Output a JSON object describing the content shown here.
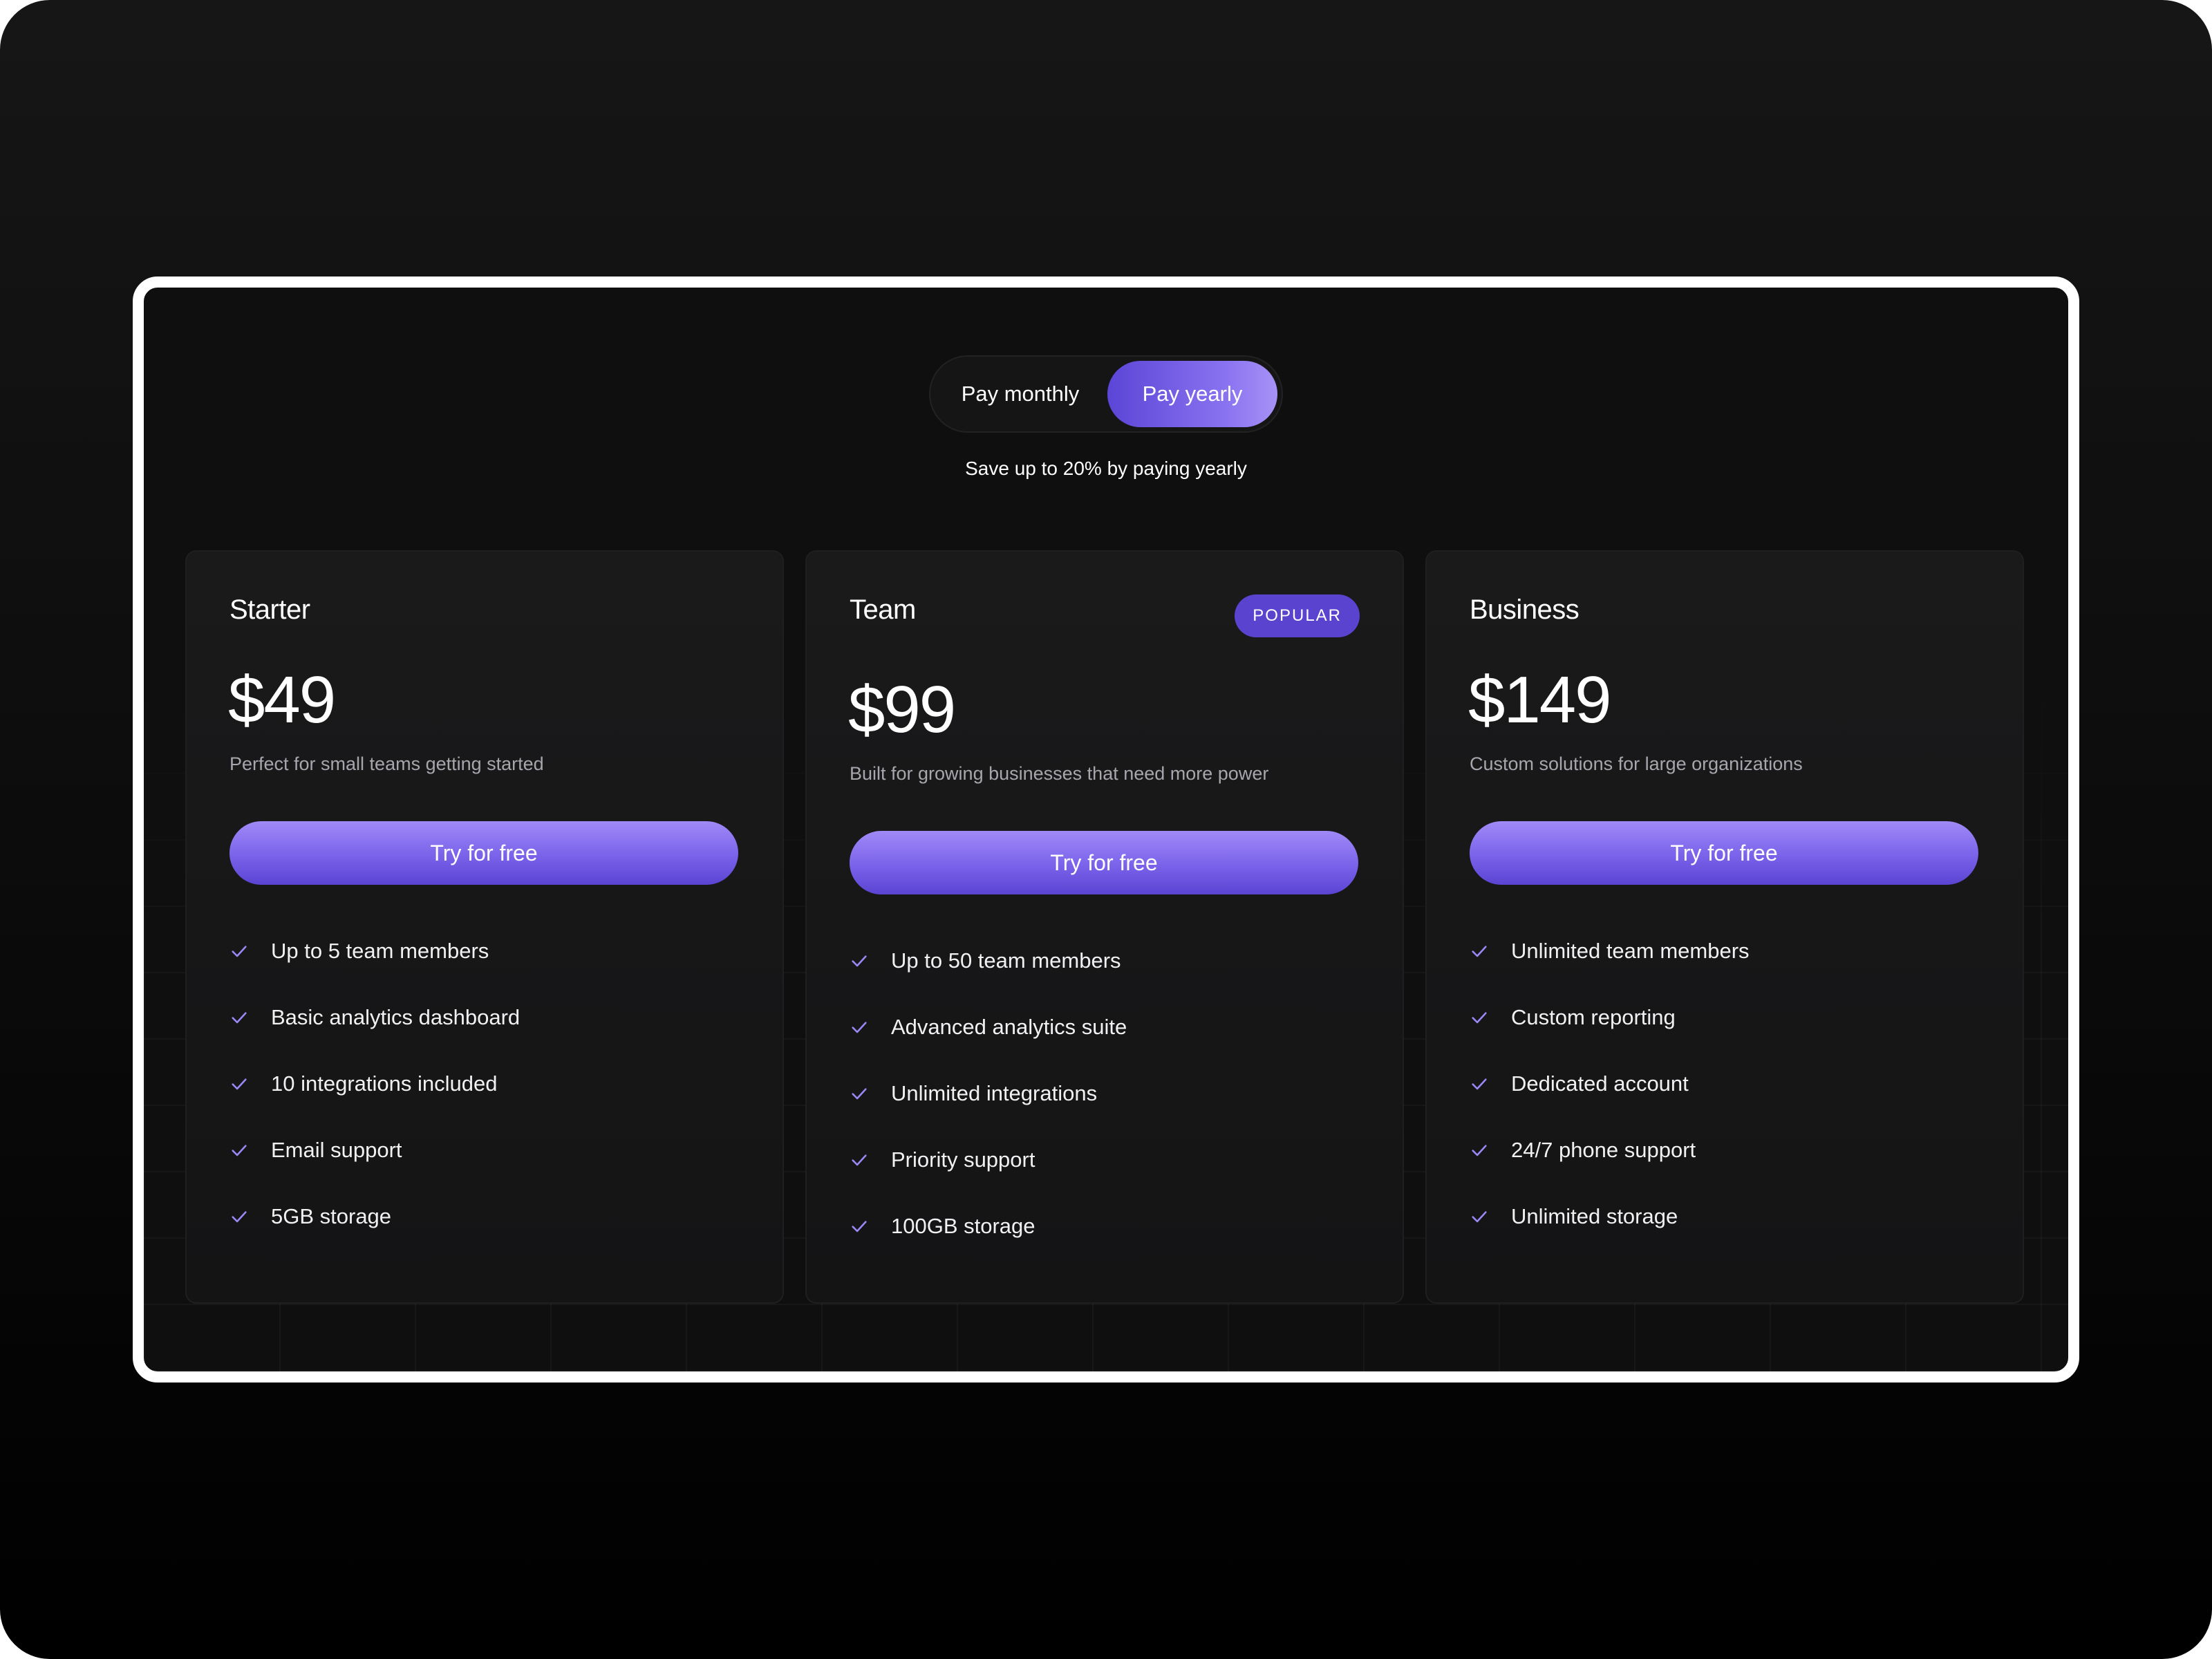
{
  "billing_toggle": {
    "monthly_label": "Pay monthly",
    "yearly_label": "Pay yearly",
    "selected": "yearly"
  },
  "save_note": "Save up to 20% by paying yearly",
  "colors": {
    "accent": "#7a62ea",
    "accent_dark": "#5a43cf",
    "check": "#9b87f5"
  },
  "plans": [
    {
      "name": "Starter",
      "price": "$49",
      "description": "Perfect for small teams getting started",
      "cta": "Try for free",
      "features": [
        "Up to 5 team members",
        "Basic analytics dashboard",
        "10 integrations included",
        "Email support",
        "5GB storage"
      ]
    },
    {
      "name": "Team",
      "badge": "POPULAR",
      "price": "$99",
      "description": "Built for growing businesses that need more power",
      "cta": "Try for free",
      "features": [
        "Up to 50 team members",
        "Advanced analytics suite",
        "Unlimited integrations",
        "Priority support",
        "100GB storage"
      ]
    },
    {
      "name": "Business",
      "price": "$149",
      "description": "Custom solutions for large organizations",
      "cta": "Try for free",
      "features": [
        "Unlimited team members",
        "Custom reporting",
        "Dedicated account",
        "24/7 phone support",
        "Unlimited storage"
      ]
    }
  ]
}
